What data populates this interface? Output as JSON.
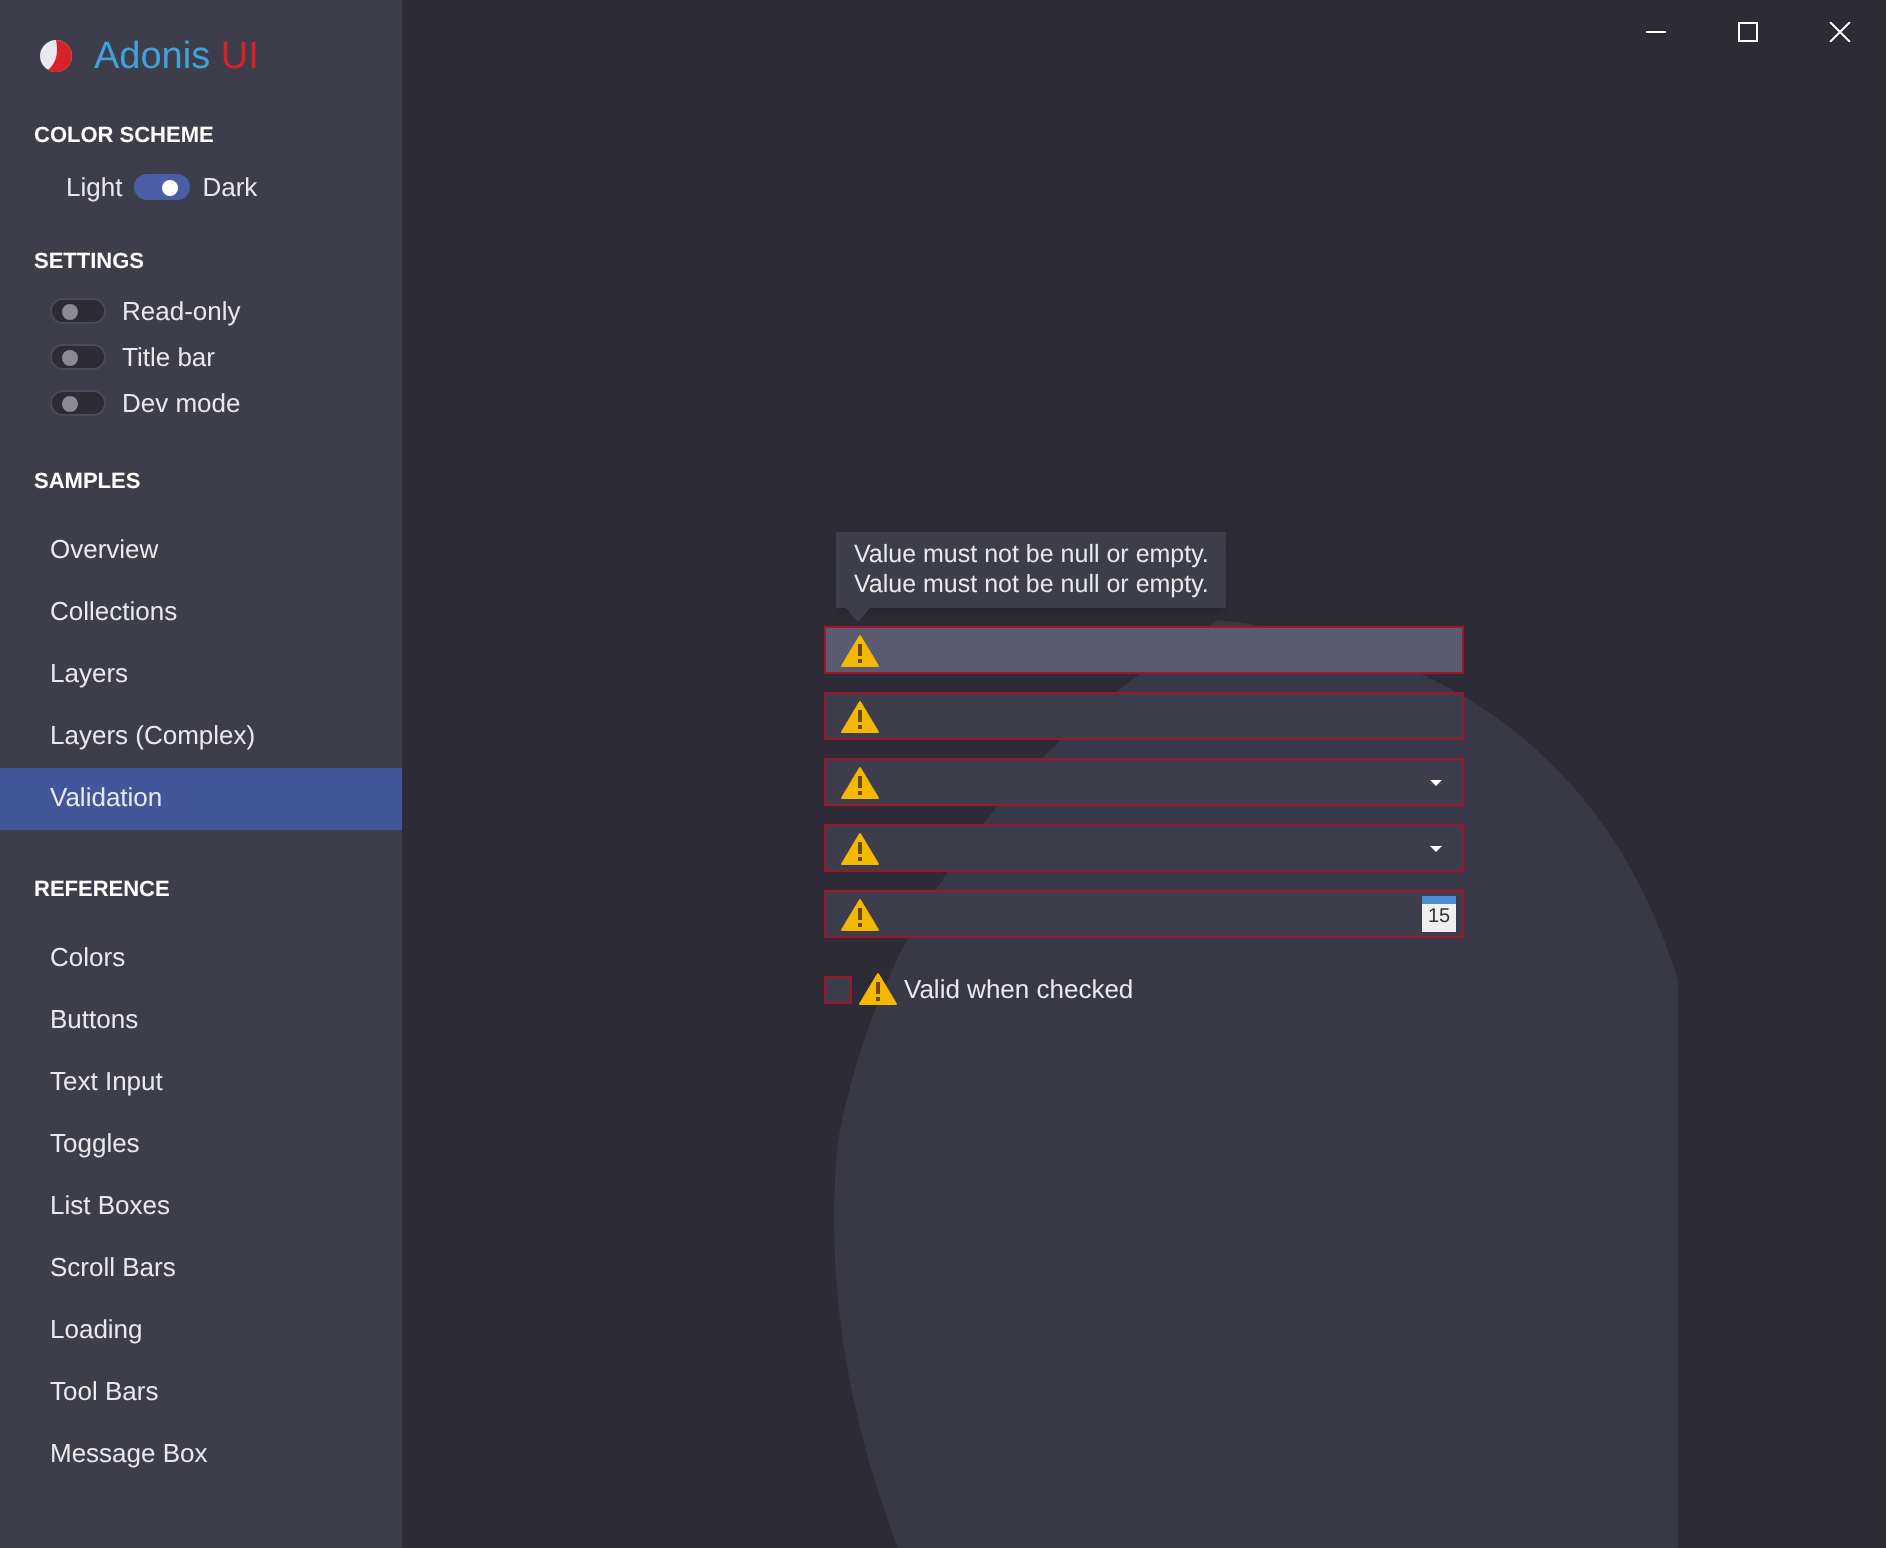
{
  "app": {
    "title_main": "Adonis",
    "title_accent": "UI"
  },
  "color_scheme": {
    "heading": "COLOR SCHEME",
    "left_label": "Light",
    "right_label": "Dark",
    "on": true
  },
  "settings": {
    "heading": "SETTINGS",
    "toggles": [
      {
        "label": "Read-only",
        "on": false
      },
      {
        "label": "Title bar",
        "on": false
      },
      {
        "label": "Dev mode",
        "on": false
      }
    ]
  },
  "samples": {
    "heading": "SAMPLES",
    "items": [
      {
        "label": "Overview",
        "selected": false
      },
      {
        "label": "Collections",
        "selected": false
      },
      {
        "label": "Layers",
        "selected": false
      },
      {
        "label": "Layers (Complex)",
        "selected": false
      },
      {
        "label": "Validation",
        "selected": true
      }
    ]
  },
  "reference": {
    "heading": "REFERENCE",
    "items": [
      {
        "label": "Colors",
        "selected": false
      },
      {
        "label": "Buttons",
        "selected": false
      },
      {
        "label": "Text Input",
        "selected": false
      },
      {
        "label": "Toggles",
        "selected": false
      },
      {
        "label": "List Boxes",
        "selected": false
      },
      {
        "label": "Scroll Bars",
        "selected": false
      },
      {
        "label": "Loading",
        "selected": false
      },
      {
        "label": "Tool Bars",
        "selected": false
      },
      {
        "label": "Message Box",
        "selected": false
      }
    ]
  },
  "tooltip": {
    "lines": [
      "Value must not be null or empty.",
      "Value must not be null or empty."
    ]
  },
  "fields": [
    {
      "kind": "text",
      "highlighted": true,
      "invalid": true
    },
    {
      "kind": "text",
      "highlighted": false,
      "invalid": true
    },
    {
      "kind": "combo",
      "highlighted": false,
      "invalid": true
    },
    {
      "kind": "combo",
      "highlighted": false,
      "invalid": true
    },
    {
      "kind": "date",
      "highlighted": false,
      "invalid": true,
      "calendar_day": "15"
    }
  ],
  "checkbox": {
    "label": "Valid when checked",
    "checked": false,
    "invalid": true
  }
}
